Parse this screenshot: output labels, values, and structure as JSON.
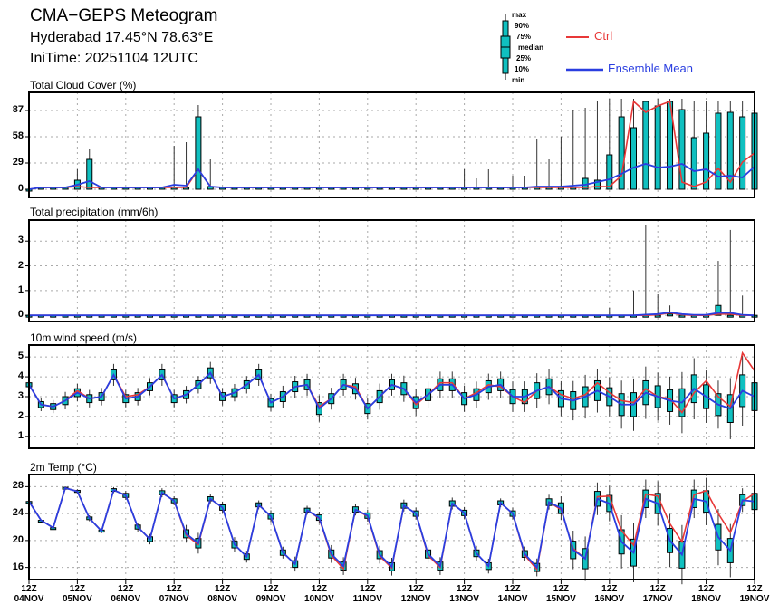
{
  "header": {
    "title": "CMA−GEPS Meteogram",
    "location": "Hyderabad 17.45°N 78.63°E",
    "init_time": "IniTime: 20251104 12UTC"
  },
  "legend": {
    "box_labels": [
      "max",
      "90%",
      "75%",
      "median",
      "25%",
      "10%",
      "min"
    ],
    "ctrl": "Ctrl",
    "mean": "Ensemble Mean",
    "ctrl_color": "#e83838",
    "mean_color": "#2a3ee0",
    "box_color": "#10c0c0"
  },
  "chart_data": [
    {
      "type": "box+line",
      "title": "Total Cloud Cover (%)",
      "yticks": [
        0,
        29,
        58,
        87
      ],
      "ylim": [
        -9,
        107
      ],
      "x_step_hours": 6,
      "ctrl": [
        0,
        2,
        2,
        2,
        3,
        2,
        2,
        2,
        2,
        2,
        2,
        2,
        2,
        2,
        22,
        3,
        2,
        2,
        2,
        2,
        2,
        2,
        2,
        2,
        2,
        2,
        2,
        2,
        2,
        2,
        2,
        2,
        2,
        2,
        2,
        2,
        2,
        2,
        2,
        2,
        2,
        2,
        2,
        2,
        2,
        2,
        2,
        3,
        3,
        15,
        97,
        85,
        92,
        97,
        8,
        3,
        8,
        23,
        8,
        30,
        40
      ],
      "mean": [
        0,
        2,
        2,
        2,
        5,
        9,
        2,
        2,
        2,
        2,
        2,
        2,
        5,
        4,
        22,
        3,
        2,
        2,
        2,
        2,
        2,
        2,
        2,
        2,
        2,
        2,
        2,
        2,
        2,
        2,
        2,
        2,
        2,
        2,
        2,
        2,
        2,
        2,
        2,
        2,
        2,
        2,
        3,
        3,
        3,
        4,
        5,
        8,
        11,
        17,
        24,
        28,
        24,
        25,
        28,
        20,
        22,
        14,
        15,
        13,
        25
      ],
      "p75": [
        0,
        2,
        2,
        2,
        10,
        33,
        2,
        2,
        2,
        2,
        2,
        2,
        2,
        2,
        80,
        3,
        2,
        2,
        2,
        2,
        2,
        2,
        2,
        2,
        2,
        2,
        2,
        2,
        2,
        2,
        2,
        2,
        2,
        2,
        2,
        2,
        2,
        2,
        2,
        2,
        2,
        2,
        2,
        2,
        2,
        2,
        12,
        10,
        38,
        80,
        68,
        97,
        92,
        97,
        88,
        57,
        62,
        84,
        85,
        80,
        84
      ],
      "max": [
        0,
        2,
        2,
        2,
        22,
        45,
        2,
        2,
        2,
        2,
        2,
        2,
        48,
        52,
        93,
        33,
        2,
        2,
        2,
        2,
        2,
        2,
        2,
        2,
        2,
        2,
        2,
        2,
        2,
        2,
        2,
        2,
        2,
        2,
        2,
        2,
        22,
        12,
        22,
        2,
        15,
        15,
        55,
        33,
        58,
        87,
        90,
        97,
        100,
        100,
        100,
        97,
        100,
        100,
        100,
        97,
        97,
        97,
        97,
        97,
        97
      ],
      "min": [
        0,
        0,
        0,
        0,
        0,
        0,
        0,
        0,
        0,
        0,
        0,
        0,
        0,
        0,
        0,
        0,
        0,
        0,
        0,
        0,
        0,
        0,
        0,
        0,
        0,
        0,
        0,
        0,
        0,
        0,
        0,
        0,
        0,
        0,
        0,
        0,
        0,
        0,
        0,
        0,
        0,
        0,
        0,
        0,
        0,
        0,
        0,
        0,
        0,
        0,
        0,
        0,
        0,
        0,
        0,
        0,
        0,
        0,
        0,
        0,
        0
      ]
    },
    {
      "type": "box+line",
      "title": "Total precipitation (mm/6h)",
      "yticks": [
        0,
        1,
        2,
        3
      ],
      "ylim": [
        -0.25,
        3.85
      ],
      "ctrl": [
        0,
        0,
        0,
        0,
        0,
        0,
        0,
        0,
        0,
        0,
        0,
        0,
        0,
        0,
        0,
        0,
        0,
        0,
        0,
        0,
        0,
        0,
        0,
        0,
        0,
        0,
        0,
        0,
        0,
        0,
        0,
        0,
        0,
        0,
        0,
        0,
        0,
        0,
        0,
        0,
        0,
        0,
        0,
        0,
        0,
        0,
        0,
        0,
        0,
        0,
        0,
        0,
        0.02,
        0.1,
        0.02,
        0,
        0,
        0.05,
        0.05,
        0,
        0
      ],
      "mean": [
        0,
        0,
        0,
        0,
        0,
        0,
        0,
        0,
        0,
        0,
        0,
        0,
        0,
        0,
        0,
        0,
        0,
        0,
        0,
        0,
        0,
        0,
        0,
        0,
        0,
        0,
        0,
        0,
        0,
        0,
        0,
        0,
        0,
        0,
        0,
        0,
        0,
        0,
        0,
        0,
        0,
        0,
        0,
        0,
        0,
        0,
        0,
        0,
        0,
        0,
        0,
        0.03,
        0.05,
        0.12,
        0.05,
        0.02,
        0.02,
        0.1,
        0.1,
        0.02,
        0
      ],
      "p75": [
        0,
        0,
        0,
        0,
        0,
        0,
        0,
        0,
        0,
        0,
        0,
        0,
        0,
        0,
        0,
        0,
        0,
        0,
        0,
        0,
        0,
        0,
        0,
        0,
        0,
        0,
        0,
        0,
        0,
        0,
        0,
        0,
        0,
        0,
        0,
        0,
        0,
        0,
        0,
        0,
        0,
        0,
        0,
        0,
        0,
        0,
        0,
        0,
        0,
        0,
        0,
        0,
        0,
        0.05,
        0,
        0,
        0,
        0.4,
        0,
        0,
        0
      ],
      "max": [
        0,
        0,
        0,
        0,
        0,
        0,
        0,
        0,
        0,
        0,
        0,
        0,
        0,
        0,
        0,
        0,
        0,
        0,
        0,
        0,
        0,
        0,
        0,
        0,
        0,
        0,
        0,
        0,
        0,
        0,
        0,
        0,
        0,
        0,
        0,
        0,
        0,
        0,
        0,
        0,
        0,
        0,
        0,
        0,
        0,
        0,
        0,
        0,
        0.3,
        0,
        1.0,
        3.65,
        0.85,
        0.4,
        0,
        0,
        0,
        2.2,
        3.45,
        0.8,
        0
      ],
      "min": [
        0,
        0,
        0,
        0,
        0,
        0,
        0,
        0,
        0,
        0,
        0,
        0,
        0,
        0,
        0,
        0,
        0,
        0,
        0,
        0,
        0,
        0,
        0,
        0,
        0,
        0,
        0,
        0,
        0,
        0,
        0,
        0,
        0,
        0,
        0,
        0,
        0,
        0,
        0,
        0,
        0,
        0,
        0,
        0,
        0,
        0,
        0,
        0,
        0,
        0,
        0,
        0,
        0,
        0,
        0,
        0,
        0,
        0,
        0,
        0,
        0
      ]
    },
    {
      "type": "box+line",
      "title": "10m wind speed (m/s)",
      "yticks": [
        1,
        2,
        3,
        4,
        5
      ],
      "ylim": [
        0.4,
        5.6
      ],
      "ctrl": [
        3.6,
        2.6,
        2.5,
        2.8,
        3.3,
        2.9,
        3.0,
        4.1,
        3.0,
        3.1,
        3.5,
        4.1,
        2.9,
        3.1,
        3.6,
        4.2,
        3.0,
        3.2,
        3.6,
        4.1,
        2.7,
        3.0,
        3.5,
        3.6,
        2.5,
        2.9,
        3.6,
        3.5,
        2.4,
        3.0,
        3.6,
        3.4,
        2.6,
        3.1,
        3.7,
        3.7,
        2.9,
        3.2,
        3.6,
        3.5,
        3.0,
        2.7,
        3.3,
        3.5,
        3.1,
        2.9,
        3.1,
        3.7,
        3.2,
        2.8,
        2.7,
        3.4,
        3.0,
        2.9,
        2.2,
        3.2,
        3.8,
        3.0,
        2.5,
        5.2,
        4.3
      ],
      "mean": [
        3.6,
        2.6,
        2.5,
        2.8,
        3.2,
        2.9,
        3.0,
        4.1,
        2.9,
        3.0,
        3.5,
        4.1,
        2.9,
        3.1,
        3.6,
        4.2,
        3.0,
        3.2,
        3.6,
        4.1,
        2.7,
        3.0,
        3.5,
        3.6,
        2.4,
        2.9,
        3.6,
        3.4,
        2.4,
        3.0,
        3.6,
        3.4,
        2.7,
        3.1,
        3.6,
        3.6,
        2.9,
        3.1,
        3.5,
        3.6,
        3.0,
        3.0,
        3.3,
        3.5,
        2.9,
        2.8,
        3.0,
        3.3,
        3.0,
        2.6,
        2.6,
        3.2,
        3.0,
        2.8,
        2.7,
        3.4,
        3.0,
        2.6,
        2.4,
        3.3,
        3.0
      ],
      "spread": [
        0.1,
        0.15,
        0.15,
        0.2,
        0.2,
        0.2,
        0.2,
        0.25,
        0.2,
        0.2,
        0.2,
        0.25,
        0.2,
        0.2,
        0.2,
        0.25,
        0.2,
        0.2,
        0.2,
        0.25,
        0.2,
        0.25,
        0.25,
        0.25,
        0.3,
        0.25,
        0.25,
        0.25,
        0.25,
        0.3,
        0.25,
        0.3,
        0.3,
        0.3,
        0.3,
        0.3,
        0.3,
        0.3,
        0.3,
        0.3,
        0.35,
        0.35,
        0.4,
        0.4,
        0.4,
        0.45,
        0.5,
        0.5,
        0.45,
        0.55,
        0.6,
        0.6,
        0.55,
        0.55,
        0.7,
        0.7,
        0.6,
        0.55,
        0.7,
        0.8,
        0.7
      ]
    },
    {
      "type": "box+line",
      "title": "2m Temp (°C)",
      "yticks": [
        16,
        20,
        24,
        28
      ],
      "ylim": [
        14.2,
        29.8
      ],
      "ctrl": [
        25.8,
        23.0,
        21.9,
        27.8,
        27.3,
        23.3,
        21.4,
        27.5,
        26.7,
        22.0,
        20.2,
        27.1,
        25.9,
        20.8,
        19.4,
        26.2,
        24.9,
        19.4,
        17.6,
        25.3,
        23.6,
        18.2,
        16.5,
        24.5,
        23.3,
        17.8,
        15.8,
        24.6,
        23.6,
        17.7,
        15.9,
        25.2,
        24.0,
        17.8,
        16.0,
        25.5,
        24.1,
        18.1,
        16.2,
        25.6,
        24.0,
        17.8,
        15.7,
        25.7,
        24.6,
        18.8,
        17.3,
        26.5,
        26.6,
        21.5,
        19.3,
        26.9,
        26.6,
        22.5,
        19.8,
        26.8,
        27.4,
        24.0,
        21.2,
        25.8,
        27.0
      ],
      "mean": [
        25.8,
        23.0,
        21.9,
        27.8,
        27.3,
        23.3,
        21.4,
        27.5,
        26.7,
        22.0,
        20.2,
        27.1,
        25.9,
        21.0,
        19.6,
        26.2,
        24.9,
        19.4,
        17.6,
        25.3,
        23.6,
        18.2,
        16.5,
        24.5,
        23.4,
        18.0,
        16.2,
        24.6,
        23.7,
        17.9,
        16.1,
        25.2,
        24.0,
        18.0,
        16.2,
        25.5,
        24.1,
        18.1,
        16.2,
        25.6,
        24.0,
        18.0,
        16.0,
        25.7,
        24.8,
        18.6,
        17.3,
        26.2,
        25.5,
        19.8,
        18.2,
        26.2,
        25.5,
        20.0,
        17.9,
        26.2,
        25.8,
        20.5,
        18.5,
        26.0,
        25.8
      ],
      "spread": [
        0,
        0,
        0,
        0.1,
        0.15,
        0.2,
        0.15,
        0.2,
        0.3,
        0.3,
        0.35,
        0.3,
        0.3,
        0.6,
        0.7,
        0.3,
        0.4,
        0.5,
        0.4,
        0.3,
        0.4,
        0.4,
        0.5,
        0.3,
        0.4,
        0.6,
        0.6,
        0.4,
        0.4,
        0.6,
        0.6,
        0.4,
        0.4,
        0.6,
        0.6,
        0.4,
        0.4,
        0.5,
        0.5,
        0.3,
        0.4,
        0.5,
        0.6,
        0.5,
        0.8,
        1.3,
        1.5,
        1.1,
        1.2,
        1.8,
        2.0,
        1.3,
        1.5,
        1.8,
        2.0,
        1.3,
        1.6,
        1.9,
        1.8,
        0.8,
        1.2
      ]
    }
  ],
  "x_axis": {
    "hour_labels": [
      "12Z",
      "12Z",
      "12Z",
      "12Z",
      "12Z",
      "12Z",
      "12Z",
      "12Z",
      "12Z",
      "12Z",
      "12Z",
      "12Z",
      "12Z",
      "12Z",
      "12Z",
      "12Z"
    ],
    "date_labels": [
      "04NOV",
      "05NOV",
      "06NOV",
      "07NOV",
      "08NOV",
      "09NOV",
      "10NOV",
      "11NOV",
      "12NOV",
      "13NOV",
      "14NOV",
      "15NOV",
      "16NOV",
      "17NOV",
      "18NOV",
      "19NOV"
    ]
  }
}
